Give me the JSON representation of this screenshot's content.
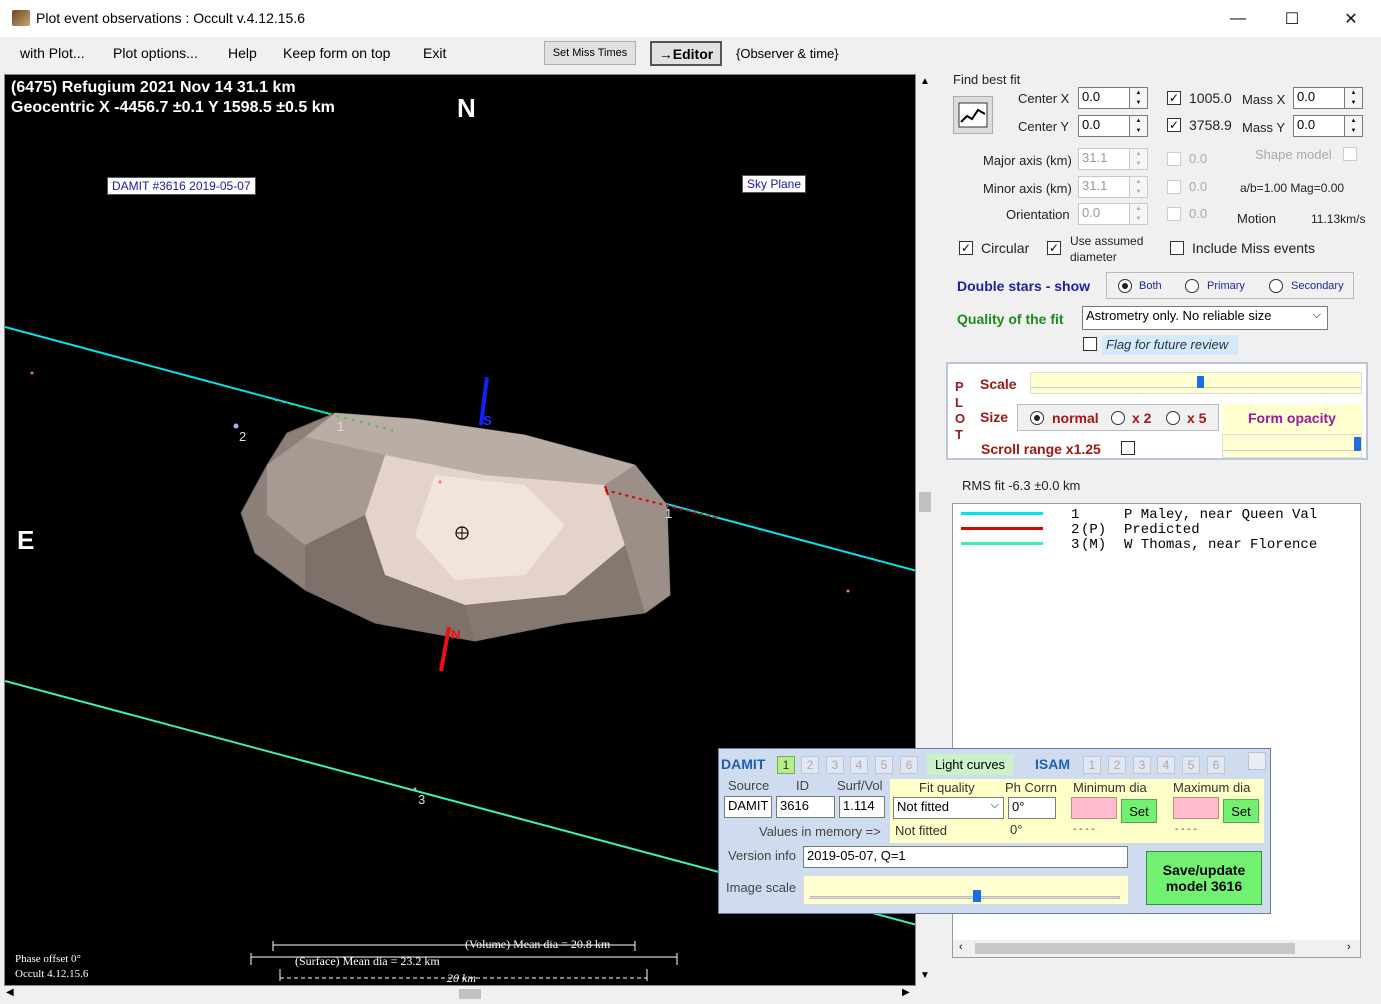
{
  "window": {
    "title": "Plot event observations : Occult v.4.12.15.6",
    "minimize": "—",
    "maximize": "☐",
    "close": "✕"
  },
  "menu": {
    "items": [
      "with Plot...",
      "Plot options...",
      "Help",
      "Keep form on top",
      "Exit"
    ],
    "set_miss_times": "Set Miss Times",
    "editor": "→Editor",
    "observer_time": "{Observer & time}"
  },
  "plot": {
    "header_line1": "(6475) Refugium  2021 Nov 14   31.1 km",
    "header_line2": "Geocentric  X  -4456.7 ±0.1  Y 1598.5 ±0.5 km",
    "north": "N",
    "east": "E",
    "damit_label": "DAMIT #3616 2019-05-07",
    "sky_plane": "Sky Plane",
    "chord_labels": [
      "1",
      "2",
      "1",
      "3"
    ],
    "pole_label_s": "S",
    "pole_label_n": "N",
    "volume_dia": "(Volume) Mean dia = 20.8 km",
    "surface_dia": "(Surface) Mean dia = 23.2 km",
    "scale_bar": "20 km",
    "phase_offset": "Phase offset 0°",
    "version": "Occult 4.12.15.6"
  },
  "fit": {
    "find_best_fit": "Find best fit",
    "center_x_label": "Center X",
    "center_x": "0.0",
    "center_y_label": "Center Y",
    "center_y": "0.0",
    "x_check_value": "1005.0",
    "y_check_value": "3758.9",
    "mass_x_label": "Mass X",
    "mass_x": "0.0",
    "mass_y_label": "Mass Y",
    "mass_y": "0.0",
    "major_label": "Major axis (km)",
    "major": "31.1",
    "minor_label": "Minor axis (km)",
    "minor": "31.1",
    "orientation_label": "Orientation",
    "orientation": "0.0",
    "zero1": "0.0",
    "zero2": "0.0",
    "zero3": "0.0",
    "shape_model": "Shape model",
    "ab_mag": "a/b=1.00  Mag=0.00",
    "motion_label": "Motion",
    "motion": "11.13km/s",
    "circular": "Circular",
    "use_assumed": "Use assumed diameter",
    "include_miss": "Include Miss events"
  },
  "double_stars": {
    "label": "Double stars - show",
    "options": [
      "Both",
      "Primary",
      "Secondary"
    ]
  },
  "quality": {
    "label": "Quality of the fit",
    "value": "Astrometry only. No reliable size",
    "flag": "Flag for future review"
  },
  "plot_ctrl": {
    "vertical": [
      "P",
      "L",
      "O",
      "T"
    ],
    "scale": "Scale",
    "size": "Size",
    "size_options": [
      "normal",
      "x 2",
      "x 5"
    ],
    "form_opacity": "Form opacity",
    "scroll_range": "Scroll range x1.25",
    "scale_level": 0.5,
    "opacity_level": 0.95
  },
  "rms": "RMS fit -6.3 ±0.0 km",
  "legend": [
    {
      "num": "1",
      "tag": "",
      "name": "P Maley, near Queen Val",
      "color": "#00e5f0"
    },
    {
      "num": "2",
      "tag": "(P)",
      "name": "Predicted",
      "color": "#e00000"
    },
    {
      "num": "3",
      "tag": "(M)",
      "name": "W Thomas, near Florence",
      "color": "#3ef0b0"
    }
  ],
  "damit": {
    "title": "DAMIT",
    "numbers": [
      "1",
      "2",
      "3",
      "4",
      "5",
      "6"
    ],
    "light_curves": "Light curves",
    "isam": "ISAM",
    "isam_numbers": [
      "1",
      "2",
      "3",
      "4",
      "5",
      "6"
    ],
    "source_h": "Source",
    "id_h": "ID",
    "surfvol_h": "Surf/Vol",
    "fitq_h": "Fit quality",
    "phcorr_h": "Ph Corrn",
    "mindia_h": "Minimum dia",
    "maxdia_h": "Maximum dia",
    "source": "DAMIT",
    "id": "3616",
    "surfvol": "1.114",
    "fitq": "Not fitted",
    "phcorr": "0°",
    "set1": "Set",
    "set2": "Set",
    "values_in_memory": "Values in memory =>",
    "mem_fitq": "Not fitted",
    "mem_ph": "0°",
    "mem_min": "- - - -",
    "mem_max": "- - - -",
    "version_label": "Version info",
    "version": "2019-05-07, Q=1",
    "image_scale": "Image scale",
    "save": "Save/update model 3616",
    "image_scale_level": 0.52
  }
}
